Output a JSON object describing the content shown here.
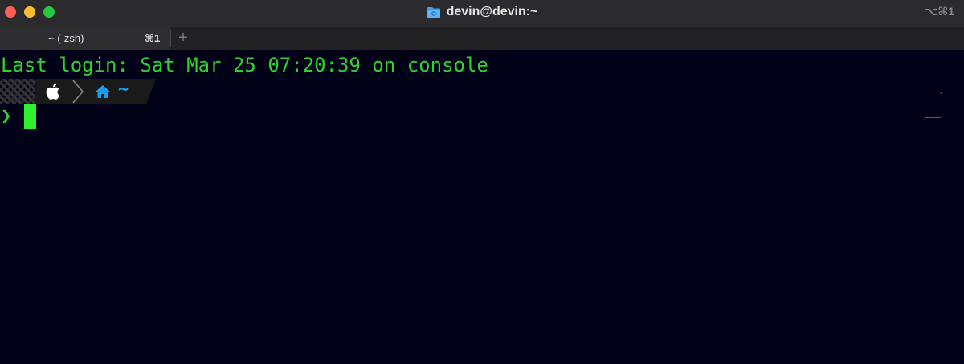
{
  "window": {
    "title": "devin@devin:~",
    "shortcut": "⌥⌘1"
  },
  "tabs": [
    {
      "label": "~ (-zsh)",
      "shortcut": "⌘1"
    }
  ],
  "new_tab_label": "+",
  "terminal": {
    "login_line": "Last login: Sat Mar 25 07:20:39 on console",
    "prompt_path": "~",
    "prompt_char": "❯",
    "colors": {
      "background": "#010218",
      "text": "#2fd32f",
      "path": "#1a9cf0",
      "cursor": "#2ef02e"
    }
  },
  "icons": {
    "title": "folder-icon",
    "os": "apple-icon",
    "home": "home-icon"
  }
}
